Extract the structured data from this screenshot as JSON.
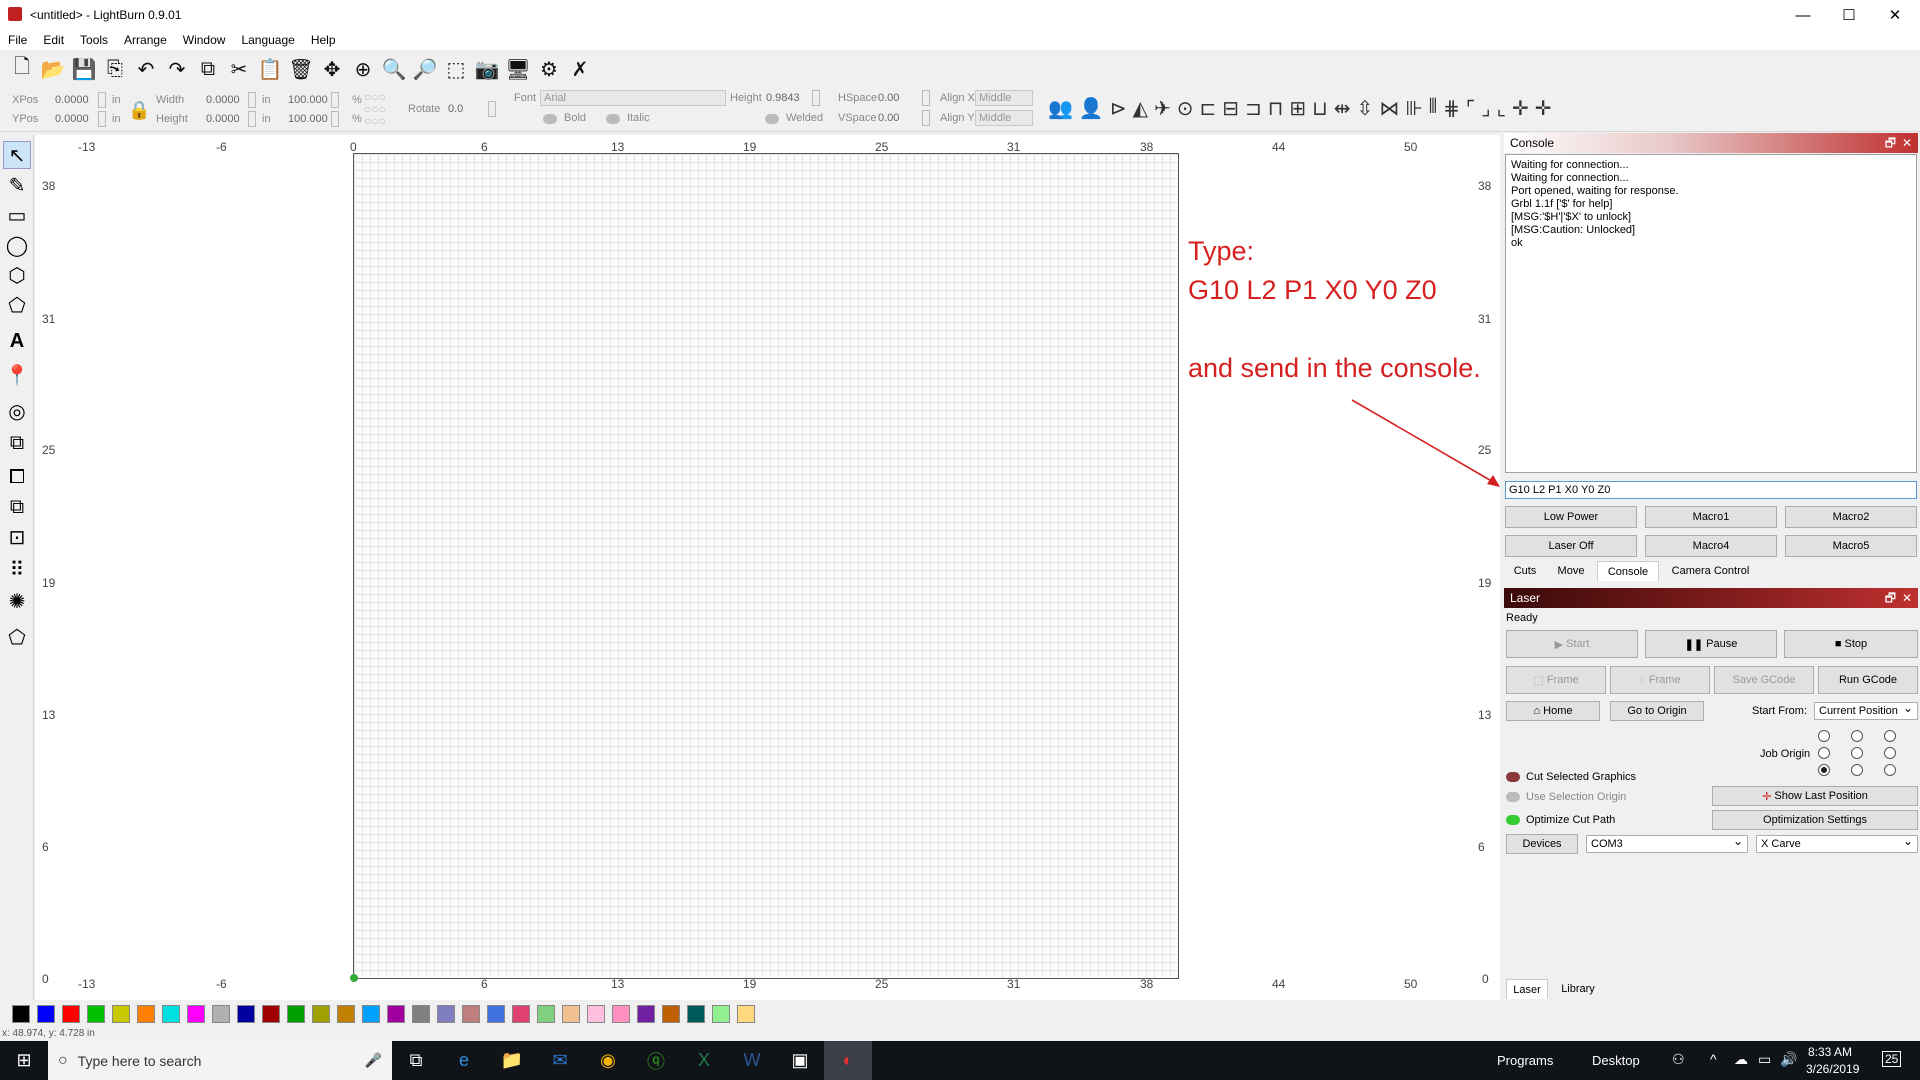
{
  "window": {
    "title": "<untitled> - LightBurn 0.9.01",
    "minimize": "—",
    "maximize": "☐",
    "close": "✕"
  },
  "menu": [
    "File",
    "Edit",
    "Tools",
    "Arrange",
    "Window",
    "Language",
    "Help"
  ],
  "numbers": {
    "xpos_label": "XPos",
    "ypos_label": "YPos",
    "xpos": "0.0000",
    "ypos": "0.0000",
    "unit_in": "in",
    "width_label": "Width",
    "height_label": "Height",
    "width": "0.0000",
    "height": "0.0000",
    "scale_w": "100.000",
    "scale_h": "100.000",
    "pct": "%",
    "rotate_label": "Rotate",
    "rotate": "0.0"
  },
  "text_props": {
    "font_label": "Font",
    "font": "Arial",
    "height_label": "Height",
    "height": "0.9843",
    "hspace_label": "HSpace",
    "hspace": "0.00",
    "vspace_label": "VSpace",
    "vspace": "0.00",
    "alignx_label": "Align X",
    "aligny_label": "Align Y",
    "alignx": "Middle",
    "aligny": "Middle",
    "bold": "Bold",
    "italic": "Italic",
    "welded": "Welded"
  },
  "rulers": {
    "top": [
      "-13",
      "-6",
      "0",
      "6",
      "13",
      "19",
      "25",
      "31",
      "38",
      "44",
      "50"
    ],
    "left": [
      "38",
      "31",
      "25",
      "19",
      "13",
      "6",
      "0"
    ],
    "right": [
      "38",
      "31",
      "25",
      "19",
      "13",
      "6",
      "0"
    ]
  },
  "annotation": {
    "line1": "Type:",
    "line2": "G10 L2 P1 X0 Y0 Z0",
    "line3": "and send in the console."
  },
  "console": {
    "title": "Console",
    "lines": [
      "Waiting for connection...",
      "Waiting for connection...",
      "Port opened, waiting for response.",
      "Grbl 1.1f ['$' for help]",
      "[MSG:'$H'|'$X' to unlock]",
      "[MSG:Caution: Unlocked]",
      "ok"
    ],
    "input": "G10 L2 P1 X0 Y0 Z0",
    "buttons": [
      "Low Power",
      "Macro1",
      "Macro2",
      "Laser Off",
      "Macro4",
      "Macro5"
    ],
    "tabs": [
      "Cuts",
      "Move",
      "Console",
      "Camera Control"
    ]
  },
  "laser": {
    "title": "Laser",
    "status": "Ready",
    "start": "Start",
    "pause": "Pause",
    "stop": "Stop",
    "frame1": "Frame",
    "frame2": "Frame",
    "save_gcode": "Save GCode",
    "run_gcode": "Run GCode",
    "home": "Home",
    "go_origin": "Go to Origin",
    "start_from_label": "Start From:",
    "start_from": "Current Position",
    "job_origin": "Job Origin",
    "cut_selected": "Cut Selected Graphics",
    "use_selection_origin": "Use Selection Origin",
    "optimize": "Optimize Cut Path",
    "show_last": "Show Last Position",
    "opt_settings": "Optimization Settings",
    "devices": "Devices",
    "port": "COM3",
    "machine": "X Carve",
    "tabs": [
      "Laser",
      "Library"
    ]
  },
  "palette": [
    "#000000",
    "#0000ff",
    "#ff0000",
    "#00c000",
    "#c8c800",
    "#ff8000",
    "#00e0e0",
    "#ff00ff",
    "#b0b0b0",
    "#0000a0",
    "#a00000",
    "#00a000",
    "#a0a000",
    "#c08000",
    "#00a0ff",
    "#a000a0",
    "#808080",
    "#7f7fc0",
    "#c07f7f",
    "#4070e0",
    "#e04070",
    "#80d080",
    "#f0c090",
    "#ffc0e0",
    "#ff90c0",
    "#7020a0",
    "#c06000",
    "#005a5a",
    "#90f090",
    "#ffd880"
  ],
  "statusbar": "x: 48.974, y: 4.728 in",
  "taskbar": {
    "search": "Type here to search",
    "programs": "Programs",
    "desktop": "Desktop",
    "time": "8:33 AM",
    "date": "3/26/2019",
    "badge": "25"
  }
}
